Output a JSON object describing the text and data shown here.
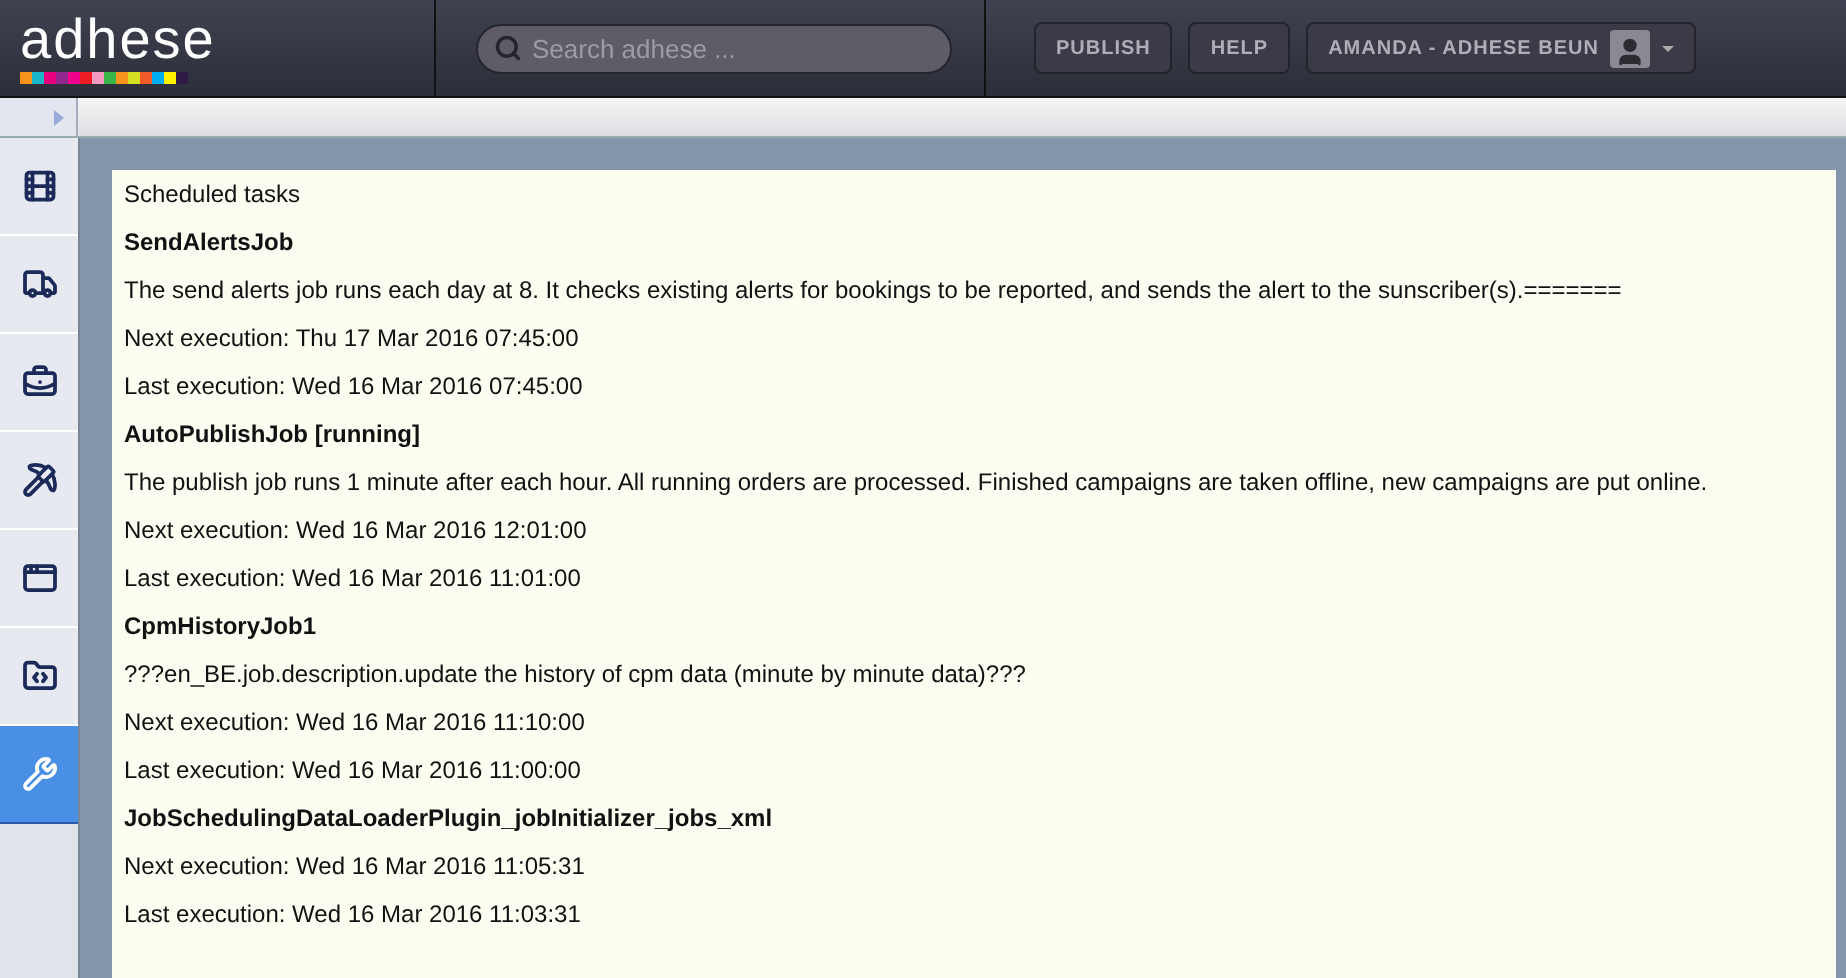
{
  "header": {
    "logo": "adhese",
    "search": {
      "placeholder": "Search adhese ..."
    },
    "buttons": [
      "PUBLISH",
      "HELP"
    ],
    "user": "AMANDA - ADHESE BEUN"
  },
  "sidebar": {
    "items": [
      {
        "kind": "film",
        "selected": false
      },
      {
        "kind": "truck",
        "selected": false
      },
      {
        "kind": "briefcase",
        "selected": false
      },
      {
        "kind": "pickaxe",
        "selected": false
      },
      {
        "kind": "window",
        "selected": false
      },
      {
        "kind": "folder",
        "selected": false
      },
      {
        "kind": "wrench",
        "selected": true
      }
    ]
  },
  "content": {
    "title": "Scheduled tasks",
    "jobs": [
      {
        "name": "SendAlertsJob",
        "description": "The send alerts job runs each day at 8. It checks existing alerts for bookings to be reported, and sends the alert to the sunscriber(s).=======",
        "next": "Next execution: Thu 17 Mar 2016 07:45:00",
        "last": "Last execution: Wed 16 Mar 2016 07:45:00"
      },
      {
        "name": "AutoPublishJob [running]",
        "description": "The publish job runs 1 minute after each hour. All running orders are processed. Finished campaigns are taken offline, new campaigns are put online.",
        "next": "Next execution: Wed 16 Mar 2016 12:01:00",
        "last": "Last execution: Wed 16 Mar 2016 11:01:00"
      },
      {
        "name": "CpmHistoryJob1",
        "description": "???en_BE.job.description.update the history of cpm data (minute by minute data)???",
        "next": "Next execution: Wed 16 Mar 2016 11:10:00",
        "last": "Last execution: Wed 16 Mar 2016 11:00:00"
      },
      {
        "name": "JobSchedulingDataLoaderPlugin_jobInitializer_jobs_xml",
        "next": "Next execution: Wed 16 Mar 2016 11:05:31",
        "last": "Last execution: Wed 16 Mar 2016 11:03:31"
      }
    ]
  }
}
